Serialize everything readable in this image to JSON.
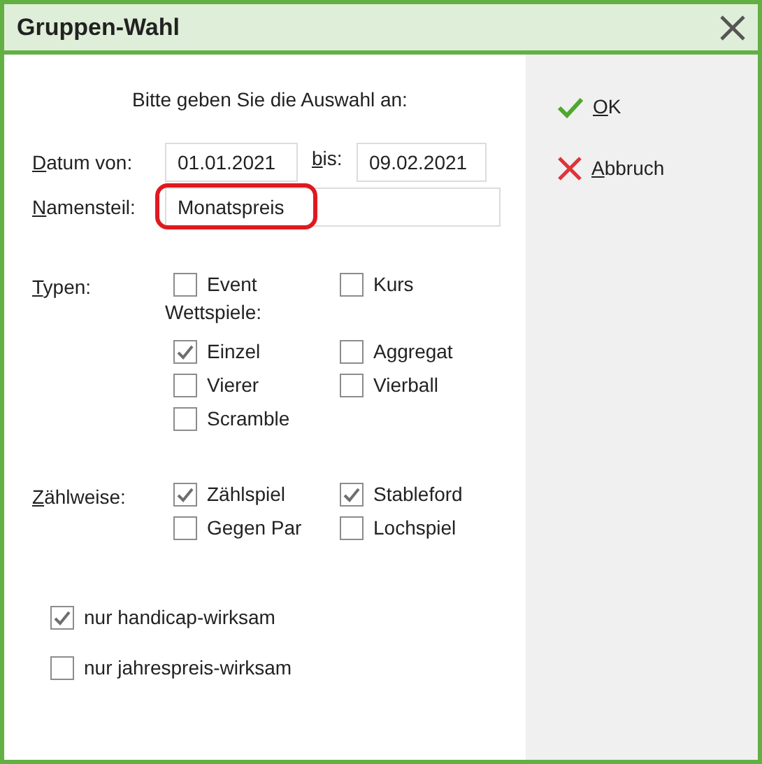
{
  "window": {
    "title": "Gruppen-Wahl"
  },
  "prompt": "Bitte geben Sie die Auswahl an:",
  "date_from": {
    "label": "Datum von:",
    "value": "01.01.2021"
  },
  "date_to": {
    "label": "bis:",
    "value": "09.02.2021"
  },
  "name_part": {
    "label": "Namensteil:",
    "value": "Monatspreis",
    "highlighted": true
  },
  "groups": [
    {
      "label": "Typen:",
      "rows": [
        {
          "kind": "checks",
          "items": [
            {
              "label": "Event",
              "checked": false
            },
            {
              "label": "Kurs",
              "checked": false
            }
          ]
        },
        {
          "kind": "heading",
          "text": "Wettspiele:"
        },
        {
          "kind": "checks",
          "items": [
            {
              "label": "Einzel",
              "checked": true
            },
            {
              "label": "Aggregat",
              "checked": false
            }
          ]
        },
        {
          "kind": "checks",
          "items": [
            {
              "label": "Vierer",
              "checked": false
            },
            {
              "label": "Vierball",
              "checked": false
            }
          ]
        },
        {
          "kind": "checks",
          "items": [
            {
              "label": "Scramble",
              "checked": false
            }
          ]
        }
      ]
    },
    {
      "label": "Zählweise:",
      "rows": [
        {
          "kind": "checks",
          "items": [
            {
              "label": "Zählspiel",
              "checked": true
            },
            {
              "label": "Stableford",
              "checked": true
            }
          ]
        },
        {
          "kind": "checks",
          "items": [
            {
              "label": "Gegen Par",
              "checked": false
            },
            {
              "label": "Lochspiel",
              "checked": false
            }
          ]
        }
      ]
    }
  ],
  "filters": [
    {
      "label": "nur handicap-wirksam",
      "checked": true
    },
    {
      "label": "nur jahrespreis-wirksam",
      "checked": false
    }
  ],
  "buttons": [
    {
      "kind": "ok",
      "label": "OK"
    },
    {
      "kind": "cancel",
      "label": "Abbruch"
    }
  ]
}
